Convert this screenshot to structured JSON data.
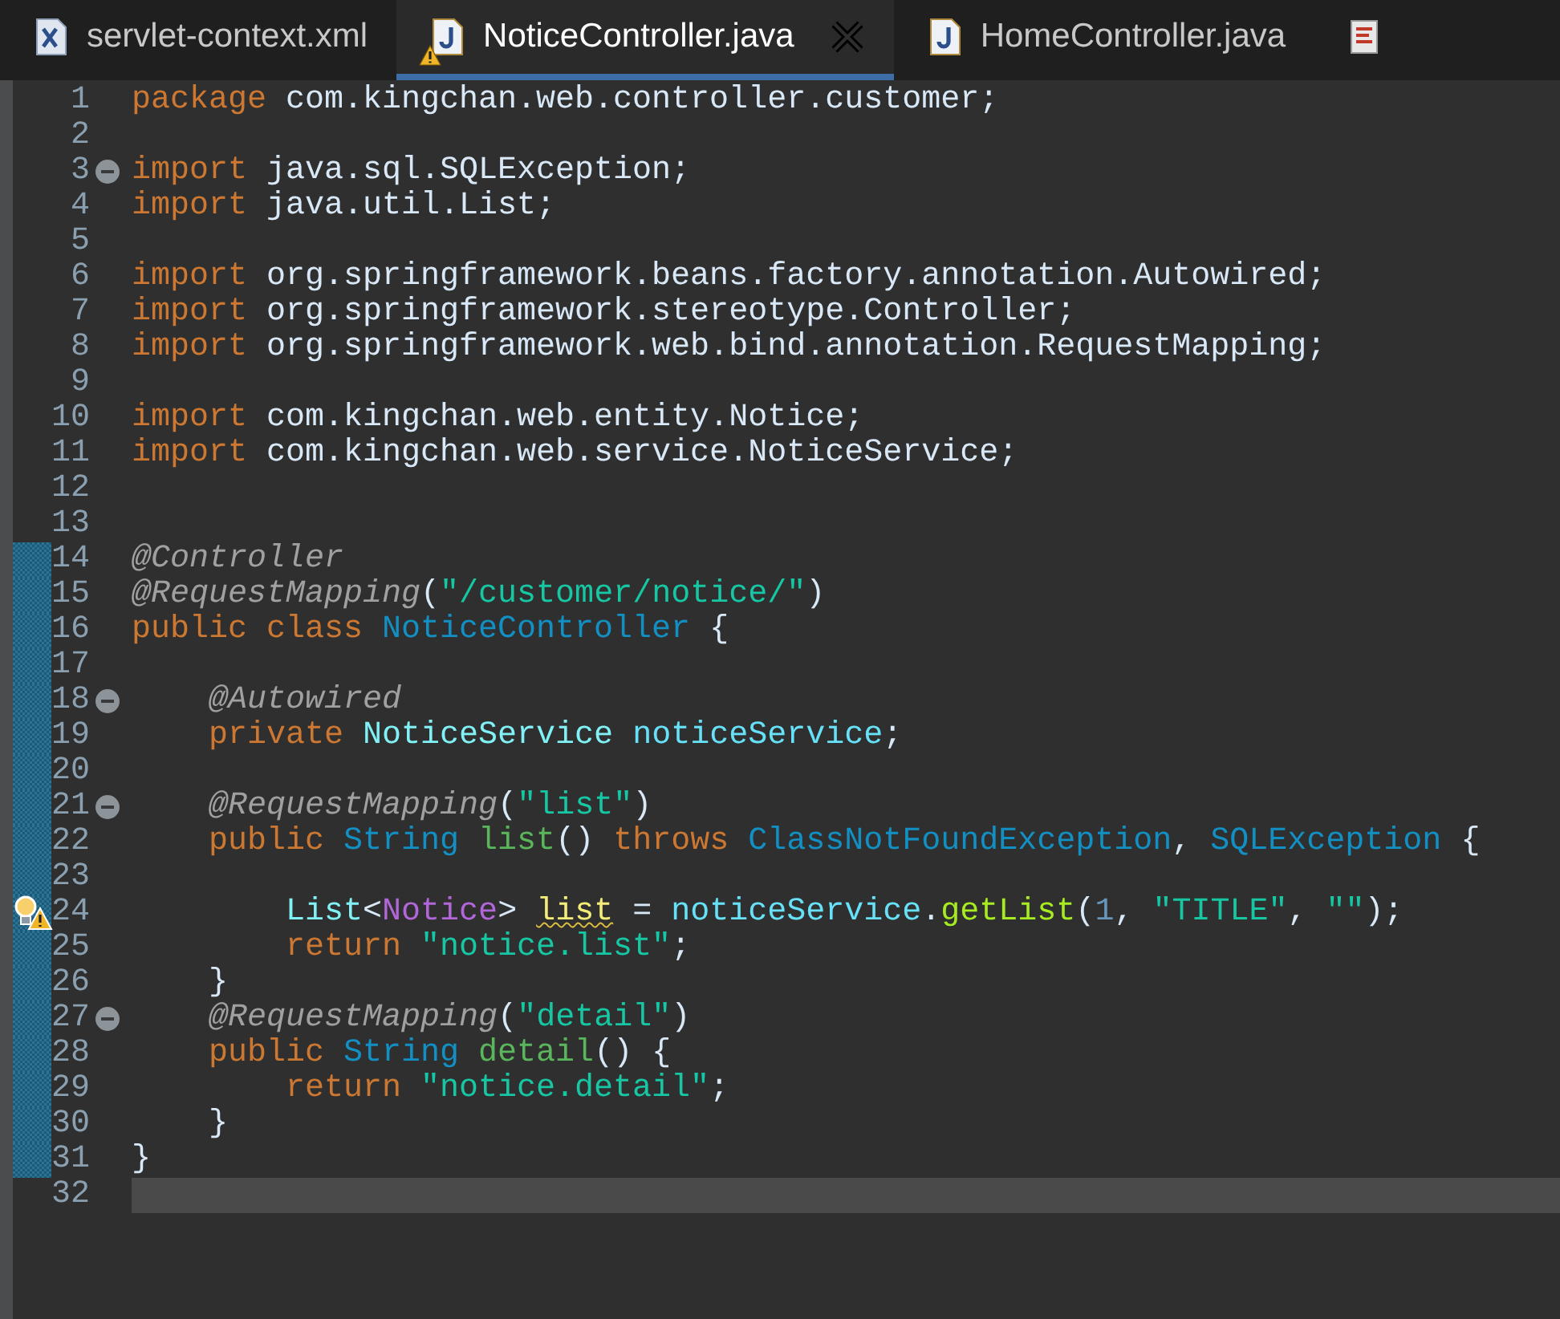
{
  "tabs": [
    {
      "label": "servlet-context.xml",
      "kind": "xml",
      "selected": false,
      "warning": false
    },
    {
      "label": "NoticeController.java",
      "kind": "java",
      "selected": true,
      "warning": true
    },
    {
      "label": "HomeController.java",
      "kind": "java",
      "selected": false,
      "warning": false
    },
    {
      "kind": "sheet",
      "selected": false,
      "warning": false
    }
  ],
  "editor": {
    "lines": [
      {
        "number": "1",
        "changed": false,
        "collapsible": false,
        "current": false,
        "tokens": [
          {
            "text": "package ",
            "kind": "keyword"
          },
          {
            "text": "com.kingchan.web.controller.customer;",
            "kind": "plain"
          }
        ]
      },
      {
        "number": "2",
        "changed": false,
        "collapsible": false,
        "current": false
      },
      {
        "number": "3",
        "changed": false,
        "collapsible": true,
        "current": false,
        "tokens": [
          {
            "text": "import ",
            "kind": "keyword"
          },
          {
            "text": "java.sql.SQLException;",
            "kind": "plain"
          }
        ]
      },
      {
        "number": "4",
        "changed": false,
        "collapsible": false,
        "current": false,
        "tokens": [
          {
            "text": "import ",
            "kind": "keyword"
          },
          {
            "text": "java.util.List;",
            "kind": "plain"
          }
        ]
      },
      {
        "number": "5",
        "changed": false,
        "collapsible": false,
        "current": false
      },
      {
        "number": "6",
        "changed": false,
        "collapsible": false,
        "current": false,
        "tokens": [
          {
            "text": "import ",
            "kind": "keyword"
          },
          {
            "text": "org.springframework.beans.factory.annotation.Autowired;",
            "kind": "plain"
          }
        ]
      },
      {
        "number": "7",
        "changed": false,
        "collapsible": false,
        "current": false,
        "tokens": [
          {
            "text": "import ",
            "kind": "keyword"
          },
          {
            "text": "org.springframework.stereotype.Controller;",
            "kind": "plain"
          }
        ]
      },
      {
        "number": "8",
        "changed": false,
        "collapsible": false,
        "current": false,
        "tokens": [
          {
            "text": "import ",
            "kind": "keyword"
          },
          {
            "text": "org.springframework.web.bind.annotation.RequestMapping;",
            "kind": "plain"
          }
        ]
      },
      {
        "number": "9",
        "changed": false,
        "collapsible": false,
        "current": false
      },
      {
        "number": "10",
        "changed": false,
        "collapsible": false,
        "current": false,
        "tokens": [
          {
            "text": "import ",
            "kind": "keyword"
          },
          {
            "text": "com.kingchan.web.entity.Notice;",
            "kind": "plain"
          }
        ]
      },
      {
        "number": "11",
        "changed": false,
        "collapsible": false,
        "current": false,
        "tokens": [
          {
            "text": "import ",
            "kind": "keyword"
          },
          {
            "text": "com.kingchan.web.service.NoticeService;",
            "kind": "plain"
          }
        ]
      },
      {
        "number": "12",
        "changed": false,
        "collapsible": false,
        "current": false
      },
      {
        "number": "13",
        "changed": false,
        "collapsible": false,
        "current": false
      },
      {
        "number": "14",
        "changed": true,
        "collapsible": false,
        "current": false,
        "tokens": [
          {
            "text": "@Controller",
            "kind": "annotation"
          }
        ]
      },
      {
        "number": "15",
        "changed": true,
        "collapsible": false,
        "current": false,
        "tokens": [
          {
            "text": "@RequestMapping",
            "kind": "annotation"
          },
          {
            "text": "(",
            "kind": "plain"
          },
          {
            "text": "\"/customer/notice/\"",
            "kind": "string"
          },
          {
            "text": ")",
            "kind": "plain"
          }
        ]
      },
      {
        "number": "16",
        "changed": true,
        "collapsible": false,
        "current": false,
        "tokens": [
          {
            "text": "public class ",
            "kind": "keyword"
          },
          {
            "text": "NoticeController",
            "kind": "type"
          },
          {
            "text": " {",
            "kind": "plain"
          }
        ]
      },
      {
        "number": "17",
        "changed": true,
        "collapsible": false,
        "current": false
      },
      {
        "number": "18",
        "changed": true,
        "collapsible": true,
        "current": false,
        "tokens": [
          {
            "text": "    @Autowired",
            "kind": "annotation"
          }
        ]
      },
      {
        "number": "19",
        "changed": true,
        "collapsible": false,
        "current": false,
        "tokens": [
          {
            "text": "    private ",
            "kind": "keyword"
          },
          {
            "text": "NoticeService ",
            "kind": "interface"
          },
          {
            "text": "noticeService",
            "kind": "field"
          },
          {
            "text": ";",
            "kind": "plain"
          }
        ]
      },
      {
        "number": "20",
        "changed": true,
        "collapsible": false,
        "current": false
      },
      {
        "number": "21",
        "changed": true,
        "collapsible": true,
        "current": false,
        "tokens": [
          {
            "text": "    @RequestMapping",
            "kind": "annotation"
          },
          {
            "text": "(",
            "kind": "plain"
          },
          {
            "text": "\"list\"",
            "kind": "string"
          },
          {
            "text": ")",
            "kind": "plain"
          }
        ]
      },
      {
        "number": "22",
        "changed": true,
        "collapsible": false,
        "current": false,
        "tokens": [
          {
            "text": "    public ",
            "kind": "keyword"
          },
          {
            "text": "String ",
            "kind": "type"
          },
          {
            "text": "list",
            "kind": "method"
          },
          {
            "text": "() ",
            "kind": "plain"
          },
          {
            "text": "throws ",
            "kind": "keyword"
          },
          {
            "text": "ClassNotFoundException",
            "kind": "type"
          },
          {
            "text": ", ",
            "kind": "plain"
          },
          {
            "text": "SQLException",
            "kind": "type"
          },
          {
            "text": " {",
            "kind": "plain"
          }
        ]
      },
      {
        "number": "23",
        "changed": true,
        "collapsible": false,
        "current": false
      },
      {
        "number": "24",
        "changed": true,
        "collapsible": false,
        "current": false,
        "warning": true,
        "tokens": [
          {
            "text": "        List",
            "kind": "interface"
          },
          {
            "text": "<",
            "kind": "plain"
          },
          {
            "text": "Notice",
            "kind": "generic"
          },
          {
            "text": "> ",
            "kind": "plain"
          },
          {
            "text": "list",
            "kind": "unused"
          },
          {
            "text": " = ",
            "kind": "plain"
          },
          {
            "text": "noticeService",
            "kind": "field"
          },
          {
            "text": ".",
            "kind": "plain"
          },
          {
            "text": "getList",
            "kind": "call"
          },
          {
            "text": "(",
            "kind": "plain"
          },
          {
            "text": "1",
            "kind": "number"
          },
          {
            "text": ", ",
            "kind": "plain"
          },
          {
            "text": "\"TITLE\"",
            "kind": "string"
          },
          {
            "text": ", ",
            "kind": "plain"
          },
          {
            "text": "\"\"",
            "kind": "string"
          },
          {
            "text": ");",
            "kind": "plain"
          }
        ]
      },
      {
        "number": "25",
        "changed": true,
        "collapsible": false,
        "current": false,
        "tokens": [
          {
            "text": "        return ",
            "kind": "keyword"
          },
          {
            "text": "\"notice.list\"",
            "kind": "string"
          },
          {
            "text": ";",
            "kind": "plain"
          }
        ]
      },
      {
        "number": "26",
        "changed": true,
        "collapsible": false,
        "current": false,
        "tokens": [
          {
            "text": "    }",
            "kind": "plain"
          }
        ]
      },
      {
        "number": "27",
        "changed": true,
        "collapsible": true,
        "current": false,
        "tokens": [
          {
            "text": "    @RequestMapping",
            "kind": "annotation"
          },
          {
            "text": "(",
            "kind": "plain"
          },
          {
            "text": "\"detail\"",
            "kind": "string"
          },
          {
            "text": ")",
            "kind": "plain"
          }
        ]
      },
      {
        "number": "28",
        "changed": true,
        "collapsible": false,
        "current": false,
        "tokens": [
          {
            "text": "    public ",
            "kind": "keyword"
          },
          {
            "text": "String ",
            "kind": "type"
          },
          {
            "text": "detail",
            "kind": "method"
          },
          {
            "text": "() {",
            "kind": "plain"
          }
        ]
      },
      {
        "number": "29",
        "changed": true,
        "collapsible": false,
        "current": false,
        "tokens": [
          {
            "text": "        return ",
            "kind": "keyword"
          },
          {
            "text": "\"notice.detail\"",
            "kind": "string"
          },
          {
            "text": ";",
            "kind": "plain"
          }
        ]
      },
      {
        "number": "30",
        "changed": true,
        "collapsible": false,
        "current": false,
        "tokens": [
          {
            "text": "    }",
            "kind": "plain"
          }
        ]
      },
      {
        "number": "31",
        "changed": true,
        "collapsible": false,
        "current": false,
        "tokens": [
          {
            "text": "}",
            "kind": "plain"
          }
        ]
      },
      {
        "number": "32",
        "changed": false,
        "collapsible": false,
        "current": true
      }
    ]
  }
}
